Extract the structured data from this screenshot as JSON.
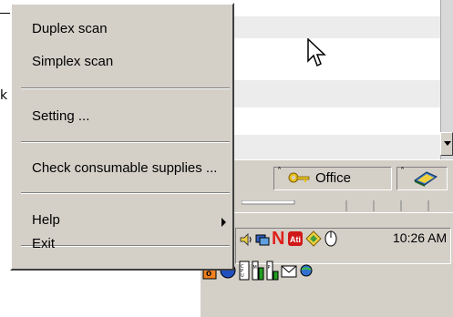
{
  "menu": {
    "items": [
      {
        "label": "Duplex scan"
      },
      {
        "label": "Simplex scan"
      },
      {
        "label": "Setting ..."
      },
      {
        "label": "Check consumable supplies ..."
      },
      {
        "label": "Help"
      },
      {
        "label": "Exit"
      }
    ]
  },
  "background": {
    "stray_char": "k",
    "toolbar": {
      "office_label": "Office"
    }
  },
  "taskbar": {
    "clock": "10:26 AM"
  },
  "icons": [
    "key-icon",
    "book-icon",
    "speaker-icon",
    "network-icon",
    "norton-icon",
    "ati-icon",
    "diamond-icon",
    "mouse-icon",
    "office-icon",
    "cpu-meter-icon",
    "mem-meter-icon",
    "page-meter-icon",
    "mail-icon",
    "globe-icon",
    "mouse-cursor-icon"
  ],
  "colors": {
    "menu_bg": "#d4d0c8",
    "norton_red": "#e0201c",
    "stripe": "#ececec"
  }
}
